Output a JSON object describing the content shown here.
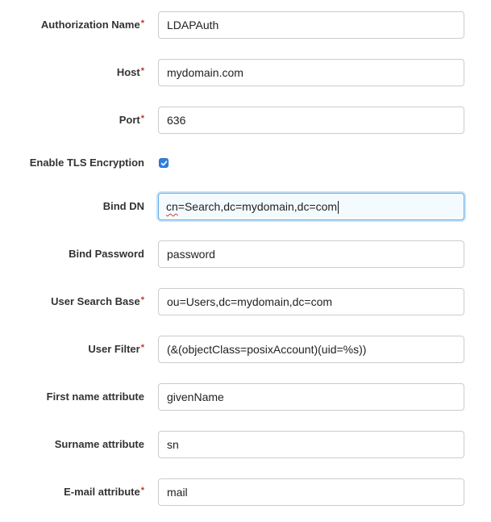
{
  "fields": {
    "authorization_name": {
      "label": "Authorization Name",
      "required": "*",
      "value": "LDAPAuth"
    },
    "host": {
      "label": "Host",
      "required": "*",
      "value": "mydomain.com"
    },
    "port": {
      "label": "Port",
      "required": "*",
      "value": "636"
    },
    "enable_tls": {
      "label": "Enable TLS Encryption",
      "checked": true
    },
    "bind_dn": {
      "label": "Bind DN",
      "value": "cn=Search,dc=mydomain,dc=com",
      "value_prefix": "cn",
      "value_rest": "=Search,dc=mydomain,dc=com"
    },
    "bind_password": {
      "label": "Bind Password",
      "value": "password"
    },
    "user_search_base": {
      "label": "User Search Base",
      "required": "*",
      "value": "ou=Users,dc=mydomain,dc=com"
    },
    "user_filter": {
      "label": "User Filter",
      "required": "*",
      "value": "(&(objectClass=posixAccount)(uid=%s))"
    },
    "first_name_attribute": {
      "label": "First name attribute",
      "value": "givenName"
    },
    "surname_attribute": {
      "label": "Surname attribute",
      "value": "sn"
    },
    "email_attribute": {
      "label": "E-mail attribute",
      "required": "*",
      "value": "mail"
    }
  },
  "colors": {
    "required_marker": "#c0392b",
    "focus_border": "#66afe9",
    "checkbox": "#2f7fe0"
  },
  "icons": {
    "checkbox": "checkmark-icon"
  }
}
